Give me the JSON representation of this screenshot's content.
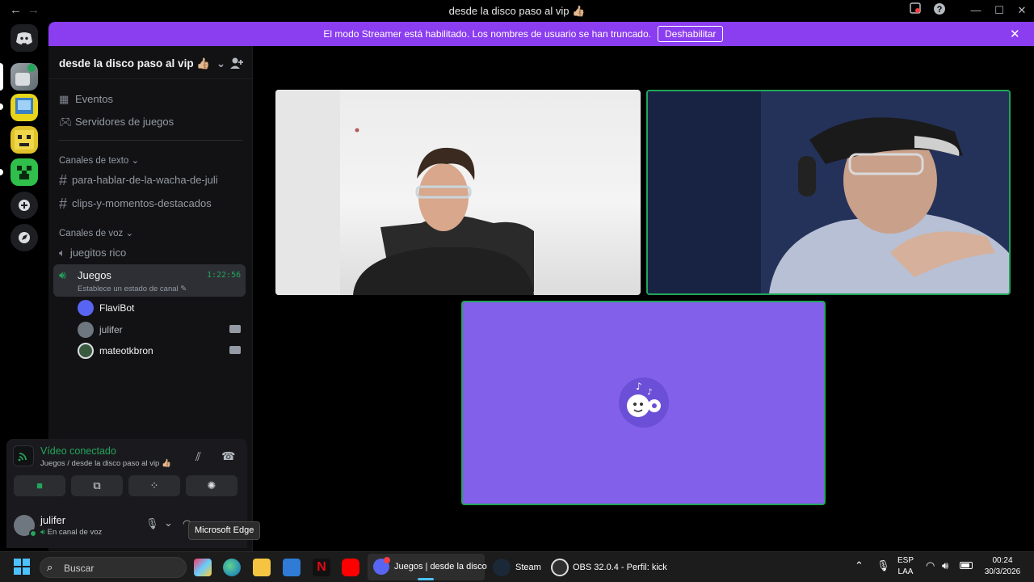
{
  "window": {
    "title": "desde la disco paso al vip 👍🏼",
    "back_icon": "←",
    "forward_icon": "→",
    "minimize": "—",
    "maximize": "☐",
    "close": "✕",
    "help_icon": "?"
  },
  "banner": {
    "text": "El modo Streamer está habilitado. Los nombres de usuario se han truncado.",
    "button": "Deshabilitar",
    "close": "✕"
  },
  "server": {
    "name": "desde la disco paso al vip 👍🏼",
    "caret": "⌄",
    "add_icon": "+"
  },
  "sidebar": {
    "events": "Eventos",
    "game_servers": "Servidores de juegos",
    "text_category": "Canales de texto",
    "text_channels": [
      "para-hablar-de-la-wacha-de-juli",
      "clips-y-momentos-destacados"
    ],
    "voice_category": "Canales de voz",
    "voice_channels": [
      "juegitos rico"
    ],
    "active_voice": {
      "name": "Juegos",
      "timer": "1:22:56",
      "status": "Establece un estado de canal ✎"
    },
    "members": [
      "FlaviBot",
      "julifer",
      "mateotkbron"
    ]
  },
  "voice_panel": {
    "status": "Vídeo conectado",
    "location": "Juegos / desde la disco paso al vip 👍🏼"
  },
  "user_panel": {
    "name": "julifer",
    "status": "En canal de voz"
  },
  "tooltip": "Microsoft Edge",
  "taskbar": {
    "search_placeholder": "Buscar",
    "discord_label": "Juegos | desde la disco",
    "steam_label": "Steam",
    "obs_label": "OBS 32.0.4 - Perfil: kick",
    "lang": "ESP",
    "layout": "LAA",
    "time": "00:24",
    "date": "30/3/2026"
  },
  "colors": {
    "accent": "#8b3df0",
    "speaking_border": "#23a55a",
    "bot_tile": "#8360ea"
  }
}
